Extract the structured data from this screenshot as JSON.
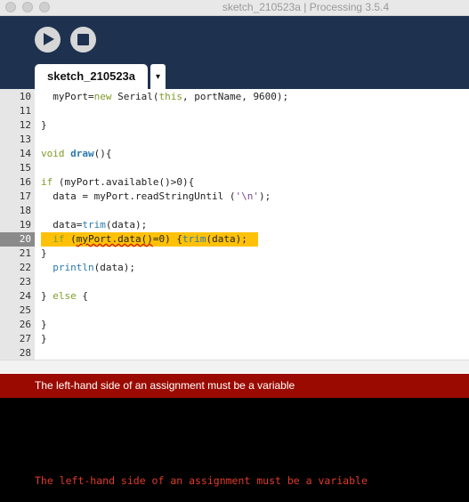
{
  "window": {
    "title": "sketch_210523a | Processing 3.5.4"
  },
  "toolbar": {
    "run_icon": "play-icon",
    "stop_icon": "stop-icon"
  },
  "tabs": {
    "active": "sketch_210523a",
    "menu_glyph": "▾"
  },
  "editor": {
    "highlight_color": "#ffc107",
    "lines": [
      {
        "num": "10",
        "text": "myPort=new Serial(this, portName, 9600);"
      },
      {
        "num": "11",
        "text": ""
      },
      {
        "num": "12",
        "text": "}"
      },
      {
        "num": "13",
        "text": ""
      },
      {
        "num": "14",
        "text": "void draw(){"
      },
      {
        "num": "15",
        "text": ""
      },
      {
        "num": "16",
        "text": "if (myPort.available()>0){"
      },
      {
        "num": "17",
        "text": "data = myPort.readStringUntil ('\\n');"
      },
      {
        "num": "18",
        "text": ""
      },
      {
        "num": "19",
        "text": "data=trim(data);"
      },
      {
        "num": "20",
        "text": "if (myPort.data()=0) {trim(data);"
      },
      {
        "num": "21",
        "text": "}"
      },
      {
        "num": "22",
        "text": "println(data);"
      },
      {
        "num": "23",
        "text": ""
      },
      {
        "num": "24",
        "text": "} else {"
      },
      {
        "num": "25",
        "text": ""
      },
      {
        "num": "26",
        "text": "}"
      },
      {
        "num": "27",
        "text": "}"
      },
      {
        "num": "28",
        "text": ""
      }
    ]
  },
  "status": {
    "message": "The left-hand side of an assignment must be a variable",
    "color": "#9a0a00"
  },
  "console": {
    "message": "The left-hand side of an assignment must be a variable",
    "color": "#e03b2b"
  }
}
